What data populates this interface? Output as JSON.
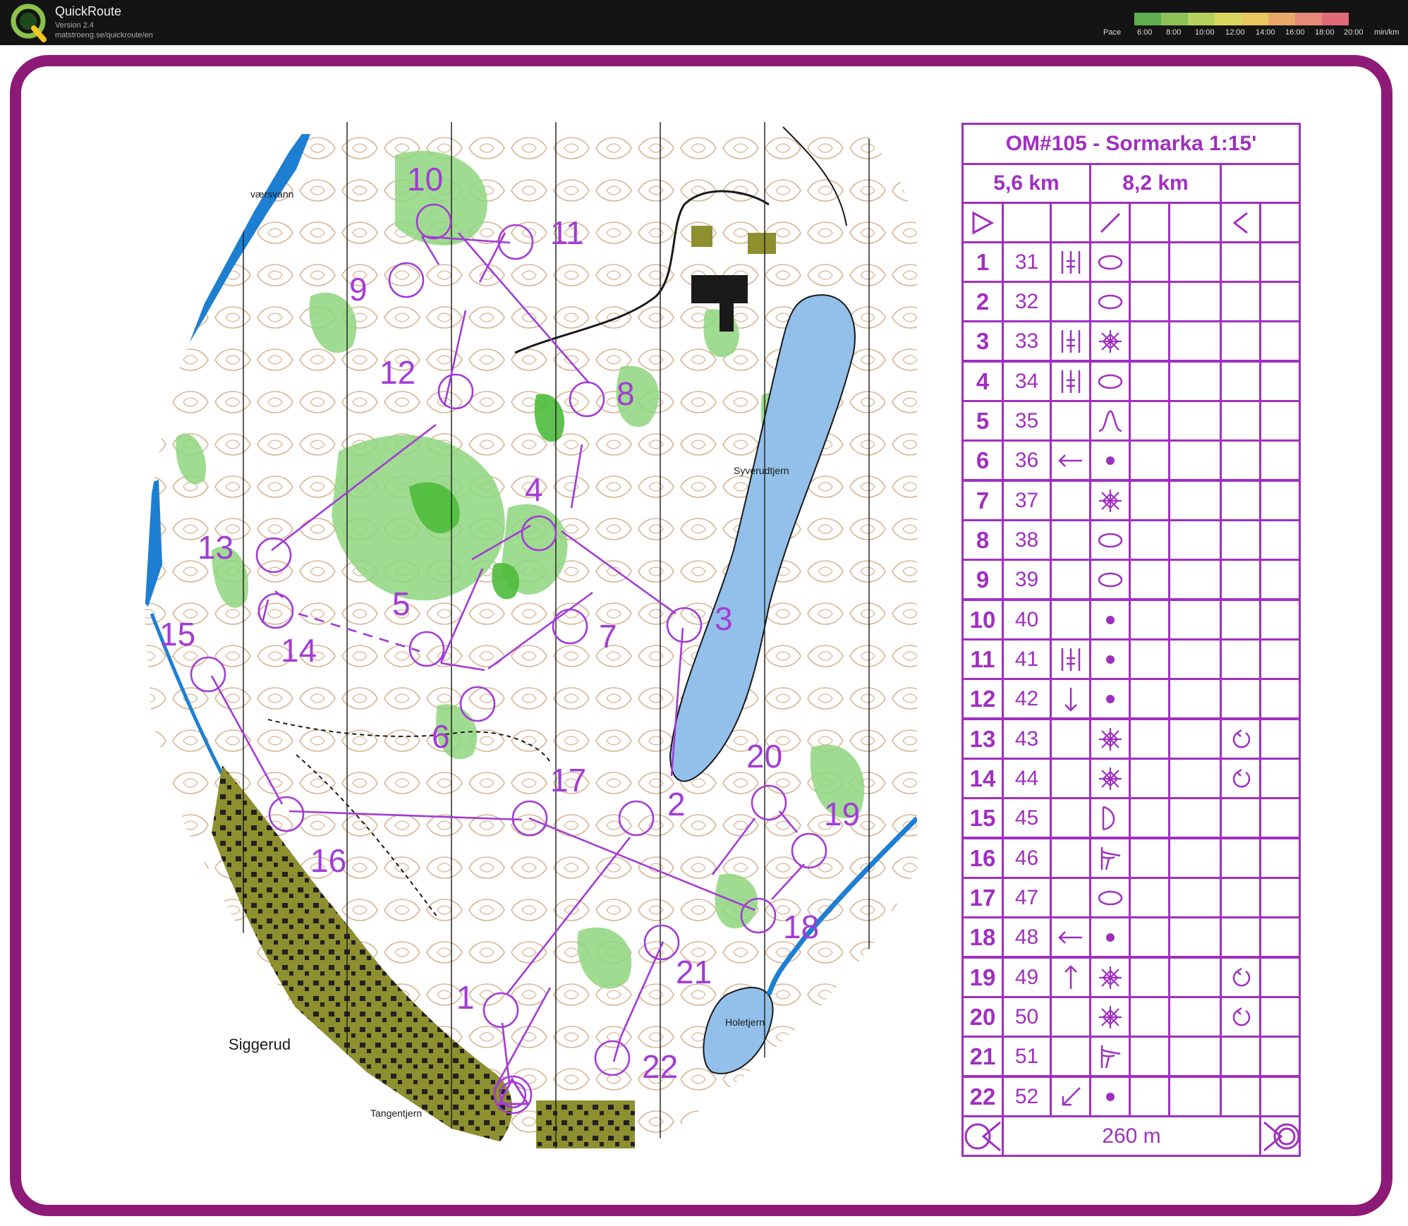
{
  "app": {
    "title": "QuickRoute",
    "version": "Version 2.4",
    "url": "matstroeng.se/quickroute/en"
  },
  "pace_scale": {
    "label": "Pace",
    "ticks": [
      "6:00",
      "8:00",
      "10:00",
      "12:00",
      "14:00",
      "16:00",
      "18:00",
      "20:00",
      "min/km"
    ],
    "colors": [
      "#5fae4f",
      "#8cc15a",
      "#b6d25e",
      "#d8d860",
      "#e9c862",
      "#e9a86a",
      "#e58a78",
      "#e06a78"
    ]
  },
  "frame_color": "#8e1a78",
  "map": {
    "course_color": "#a33bd6",
    "place_names": {
      "lake_nw": "værsvann",
      "lake_east": "Syverudtjern",
      "village": "Siggerud",
      "lake_se": "Holetjern",
      "lake_s": "Tangentjern"
    },
    "control_numbers": [
      "1",
      "2",
      "3",
      "4",
      "5",
      "6",
      "7",
      "8",
      "9",
      "10",
      "11",
      "12",
      "13",
      "14",
      "15",
      "16",
      "17",
      "18",
      "19",
      "20",
      "21",
      "22"
    ]
  },
  "description_sheet": {
    "title": "OM#105 - Sormarka 1:15'",
    "distances": [
      "5,6 km",
      "8,2 km"
    ],
    "controls": [
      {
        "num": "1",
        "code": "31",
        "dir": "",
        "feature": "slash2",
        "shape": "ellipse",
        "appear": ""
      },
      {
        "num": "2",
        "code": "32",
        "dir": "",
        "feature": "",
        "shape": "ellipse",
        "appear": ""
      },
      {
        "num": "3",
        "code": "33",
        "dir": "",
        "feature": "slash2",
        "shape": "star",
        "appear": ""
      },
      {
        "num": "4",
        "code": "34",
        "dir": "",
        "feature": "slash2",
        "shape": "ellipse",
        "appear": ""
      },
      {
        "num": "5",
        "code": "35",
        "dir": "",
        "feature": "",
        "shape": "hill",
        "appear": ""
      },
      {
        "num": "6",
        "code": "36",
        "dir": "left",
        "feature": "",
        "shape": "dot",
        "appear": ""
      },
      {
        "num": "7",
        "code": "37",
        "dir": "",
        "feature": "",
        "shape": "star",
        "appear": ""
      },
      {
        "num": "8",
        "code": "38",
        "dir": "",
        "feature": "",
        "shape": "ellipse",
        "appear": ""
      },
      {
        "num": "9",
        "code": "39",
        "dir": "",
        "feature": "",
        "shape": "ellipse",
        "appear": ""
      },
      {
        "num": "10",
        "code": "40",
        "dir": "",
        "feature": "",
        "shape": "dot",
        "appear": ""
      },
      {
        "num": "11",
        "code": "41",
        "dir": "",
        "feature": "slash2",
        "shape": "dot",
        "appear": ""
      },
      {
        "num": "12",
        "code": "42",
        "dir": "down",
        "feature": "",
        "shape": "dot",
        "appear": ""
      },
      {
        "num": "13",
        "code": "43",
        "dir": "",
        "feature": "",
        "shape": "star",
        "appear": "loop"
      },
      {
        "num": "14",
        "code": "44",
        "dir": "",
        "feature": "",
        "shape": "star",
        "appear": "loop"
      },
      {
        "num": "15",
        "code": "45",
        "dir": "",
        "feature": "",
        "shape": "bend",
        "appear": ""
      },
      {
        "num": "16",
        "code": "46",
        "dir": "",
        "feature": "",
        "shape": "foot",
        "appear": ""
      },
      {
        "num": "17",
        "code": "47",
        "dir": "",
        "feature": "",
        "shape": "ellipse",
        "appear": ""
      },
      {
        "num": "18",
        "code": "48",
        "dir": "left",
        "feature": "",
        "shape": "dot",
        "appear": ""
      },
      {
        "num": "19",
        "code": "49",
        "dir": "up",
        "feature": "",
        "shape": "star",
        "appear": "loop"
      },
      {
        "num": "20",
        "code": "50",
        "dir": "",
        "feature": "",
        "shape": "star",
        "appear": "loop"
      },
      {
        "num": "21",
        "code": "51",
        "dir": "",
        "feature": "",
        "shape": "foot",
        "appear": ""
      },
      {
        "num": "22",
        "code": "52",
        "dir": "downleft",
        "feature": "",
        "shape": "dot",
        "appear": ""
      }
    ],
    "finish_distance": "260 m"
  }
}
